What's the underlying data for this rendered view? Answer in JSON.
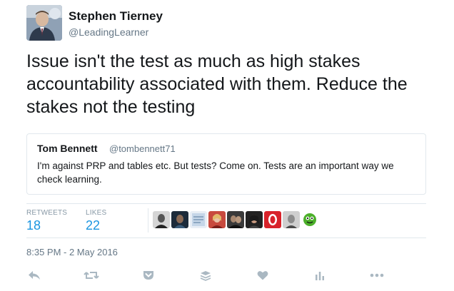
{
  "author": {
    "name": "Stephen Tierney",
    "handle": "@LeadingLearner"
  },
  "tweet": {
    "text": "Issue isn't the test as much as high stakes accountability associated with them. Reduce the stakes not the testing"
  },
  "quoted_tweet": {
    "name": "Tom Bennett",
    "handle": "@tombennett71",
    "text": "I'm against PRP and tables etc. But tests? Come on. Tests are an important way we check learning."
  },
  "stats": {
    "retweets_label": "RETWEETS",
    "retweets_count": "18",
    "likes_label": "LIKES",
    "likes_count": "22"
  },
  "timestamp": "8:35 PM - 2 May 2016",
  "colors": {
    "accent": "#1b95e0",
    "muted": "#8899a6",
    "text": "#14171a",
    "border": "#e1e8ed"
  },
  "actions": [
    {
      "name": "reply-icon"
    },
    {
      "name": "retweet-icon"
    },
    {
      "name": "pocket-icon"
    },
    {
      "name": "buffer-icon"
    },
    {
      "name": "like-icon"
    },
    {
      "name": "analytics-icon"
    },
    {
      "name": "more-icon"
    }
  ]
}
